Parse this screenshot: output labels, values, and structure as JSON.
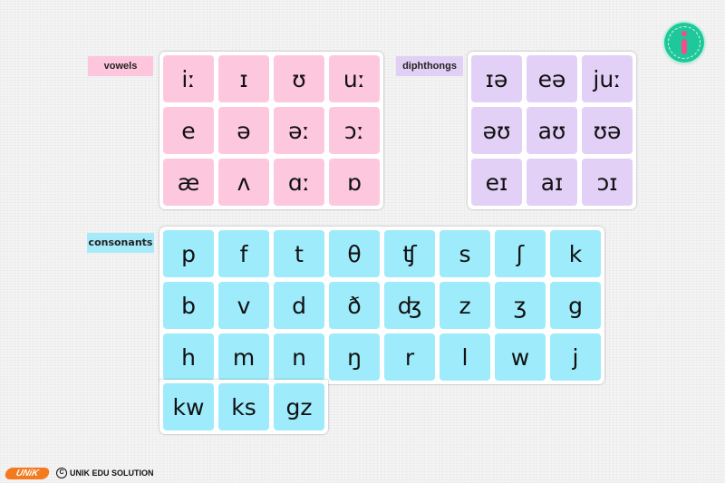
{
  "sections": {
    "vowels": {
      "label": "vowels",
      "items": [
        "iː",
        "ɪ",
        "ʊ",
        "uː",
        "e",
        "ə",
        "əː",
        "ɔː",
        "æ",
        "ʌ",
        "ɑː",
        "ɒ"
      ]
    },
    "diphthongs": {
      "label": "diphthongs",
      "items": [
        "ɪə",
        "eə",
        "juː",
        "əʊ",
        "aʊ",
        "ʊə",
        "eɪ",
        "aɪ",
        "ɔɪ"
      ]
    },
    "consonants": {
      "label": "consonants",
      "items": [
        "p",
        "f",
        "t",
        "θ",
        "ʧ",
        "s",
        "ʃ",
        "k",
        "b",
        "v",
        "d",
        "ð",
        "ʤ",
        "z",
        "ʒ",
        "g",
        "h",
        "m",
        "n",
        "ŋ",
        "r",
        "l",
        "w",
        "j"
      ],
      "extra": [
        "kw",
        "ks",
        "gz"
      ]
    }
  },
  "info_button": {
    "icon": "info-icon"
  },
  "footer": {
    "logo": "UNiK",
    "copyright_symbol": "C",
    "copyright": "UNIK EDU SOLUTION"
  },
  "colors": {
    "vowel": "#fdc8de",
    "diphthong": "#e3d0f7",
    "consonant": "#9eebfb",
    "info": "#1ec89a",
    "logo": "#f47a20"
  }
}
